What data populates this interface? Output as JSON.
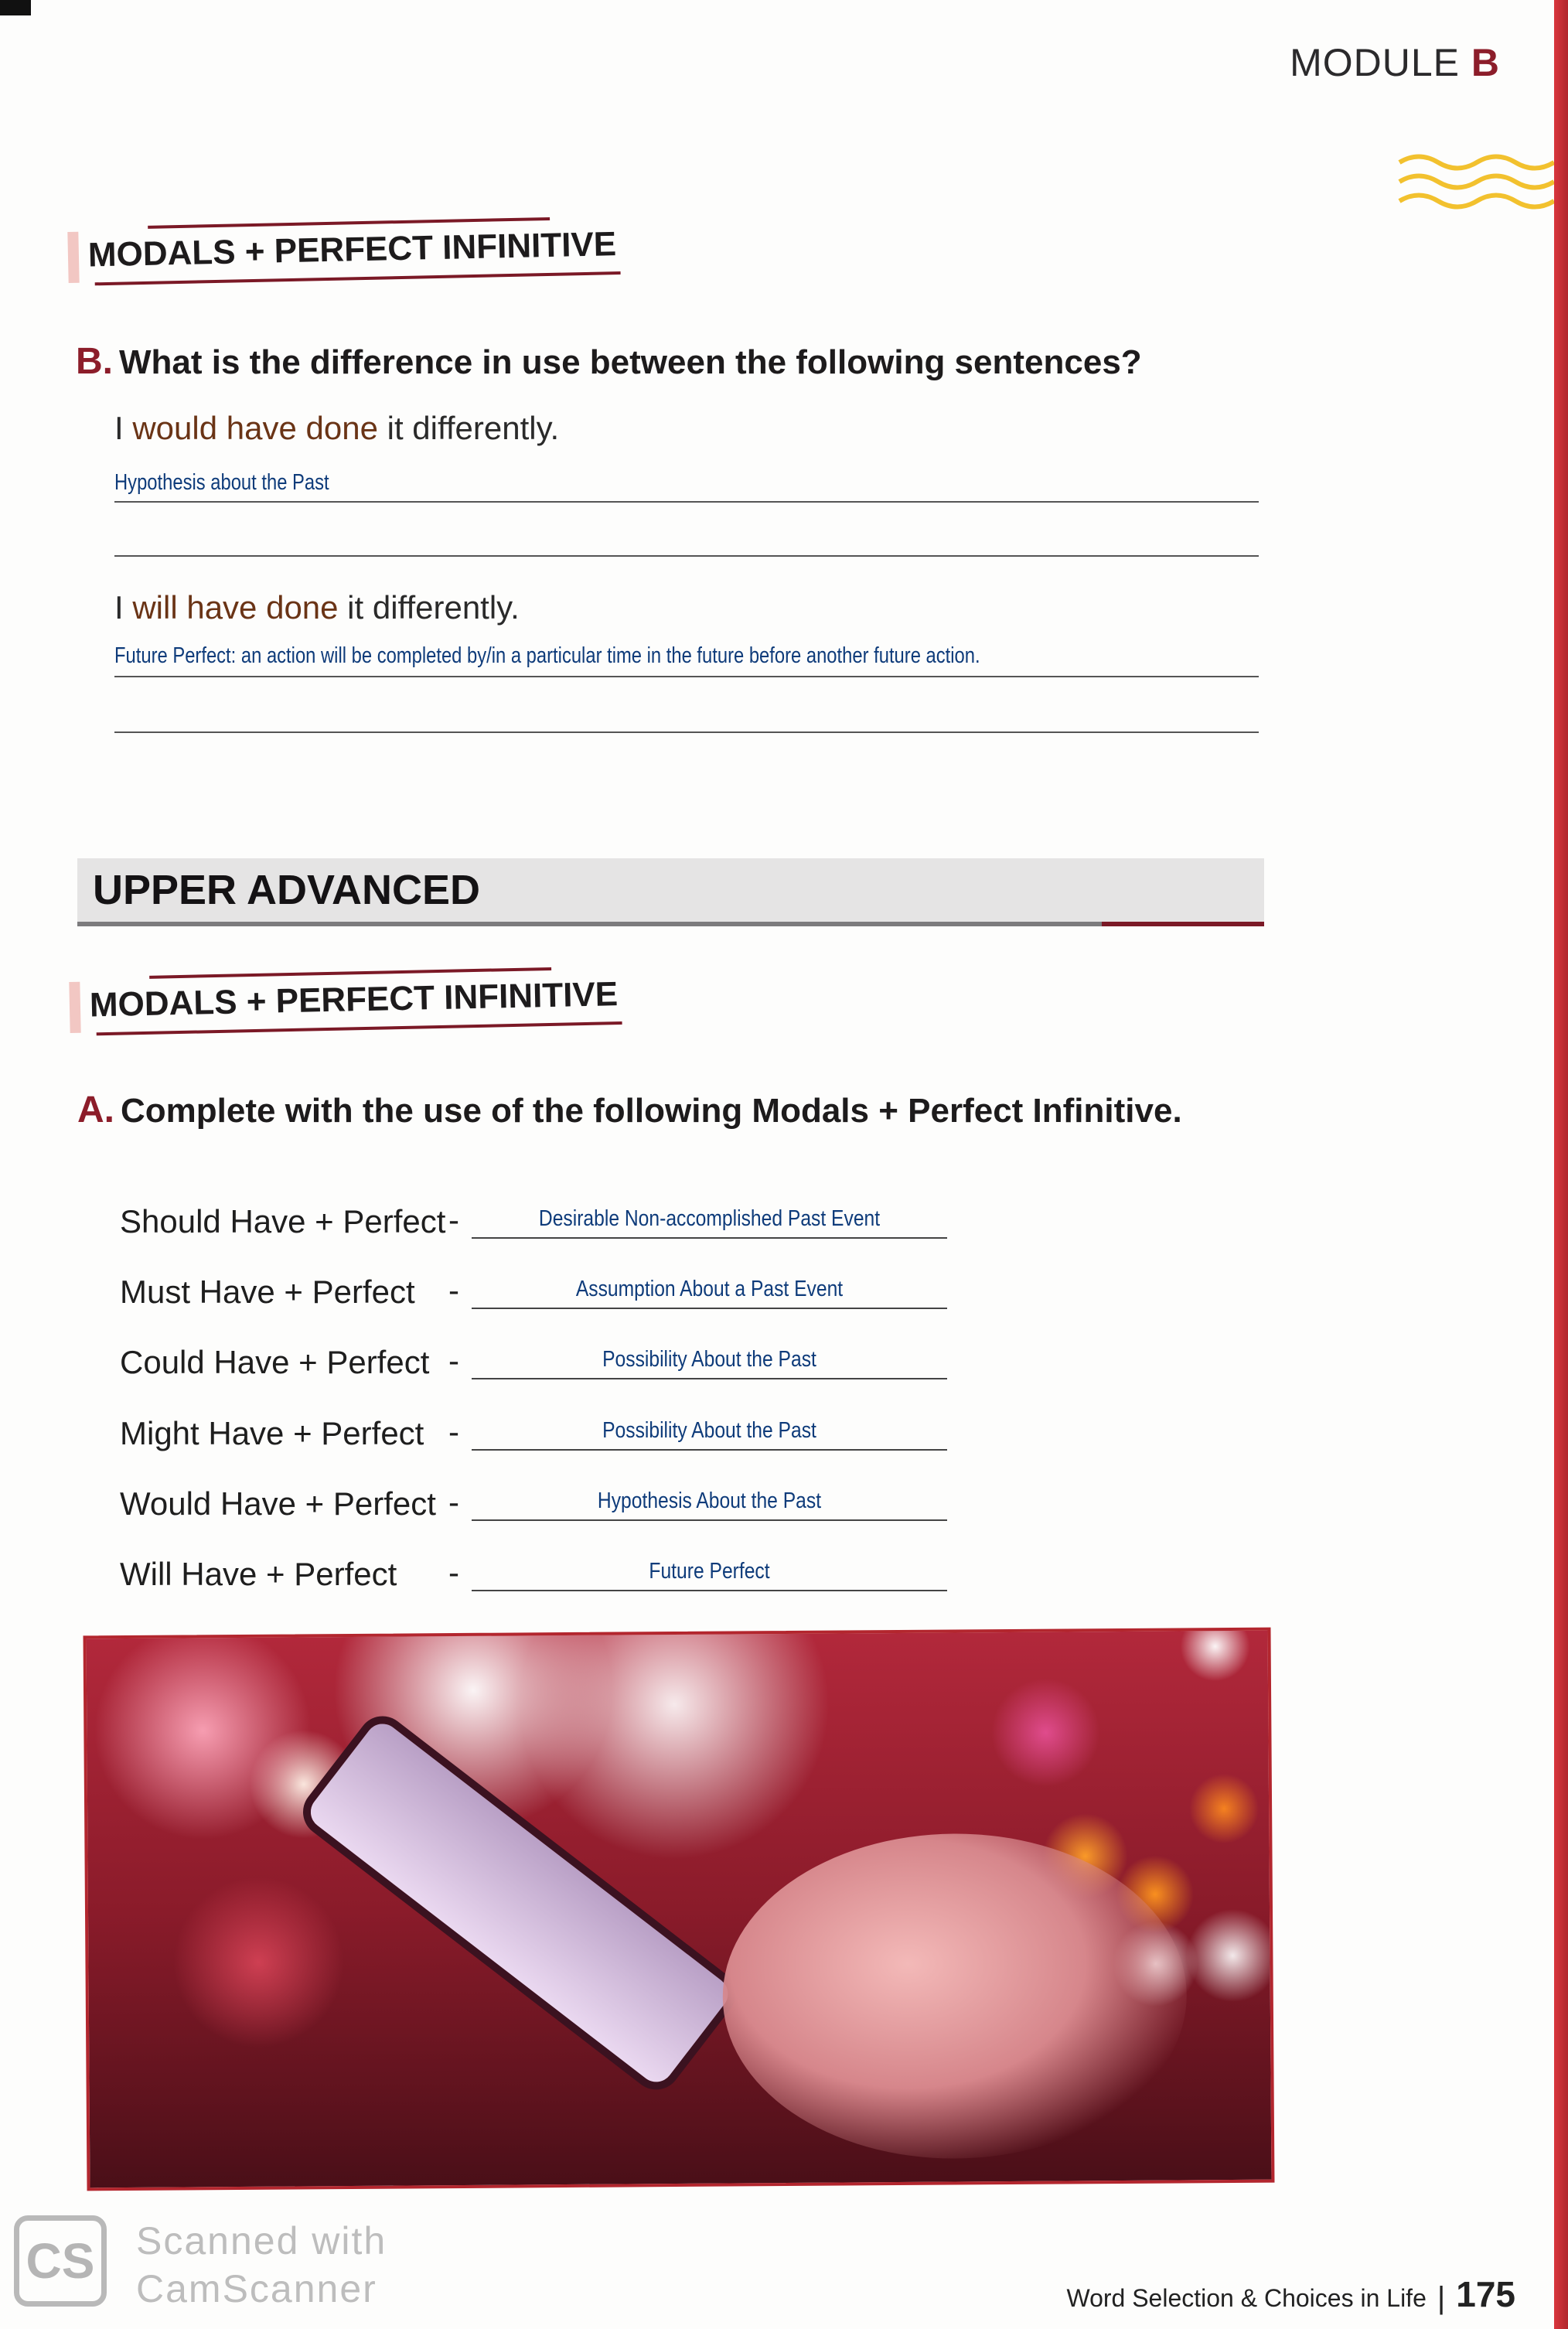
{
  "header": {
    "module_word": "MODULE",
    "module_letter": "B"
  },
  "section1": {
    "title": "MODALS + PERFECT INFINITIVE",
    "question_letter": "B.",
    "question_text": "What is the difference in use between the following sentences?",
    "sentences": [
      {
        "prefix": "I ",
        "modal": "would have done",
        "suffix": " it differently.",
        "answer": "Hypothesis about the Past"
      },
      {
        "prefix": "I ",
        "modal": "will have done",
        "suffix": " it differently.",
        "answer": "Future Perfect: an action will be completed by/in a particular time in the future before another future action."
      }
    ]
  },
  "upper_banner": "UPPER ADVANCED",
  "section2": {
    "title": "MODALS + PERFECT INFINITIVE",
    "question_letter": "A.",
    "question_text": "Complete with the use of the following Modals + Perfect Infinitive.",
    "dash": "-",
    "rows": [
      {
        "label": "Should Have + Perfect",
        "answer": "Desirable Non-accomplished Past Event"
      },
      {
        "label": "Must Have + Perfect",
        "answer": "Assumption About a Past Event"
      },
      {
        "label": "Could Have + Perfect",
        "answer": "Possibility About the Past"
      },
      {
        "label": "Might Have + Perfect",
        "answer": "Possibility About the Past"
      },
      {
        "label": "Would Have + Perfect",
        "answer": "Hypothesis About the Past"
      },
      {
        "label": "Will Have + Perfect",
        "answer": "Future Perfect"
      }
    ]
  },
  "watermark": {
    "logo": "CS",
    "line1": "Scanned with",
    "line2": "CamScanner"
  },
  "footer": {
    "book_title": "Word Selection & Choices in Life",
    "page_number": "175"
  },
  "colors": {
    "accent": "#8c1d2a",
    "handwriting": "#0e3b7a",
    "photo_border": "#b3262e"
  }
}
